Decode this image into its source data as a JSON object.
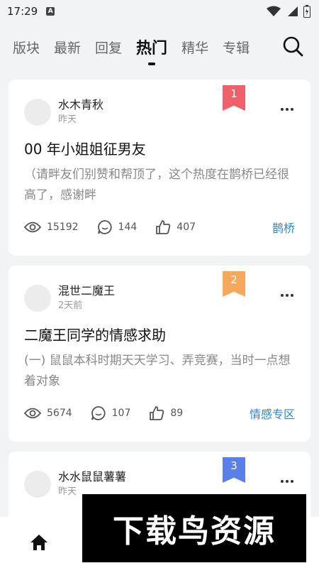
{
  "status_bar": {
    "time": "17:29",
    "notification_badge": "A"
  },
  "tabs": [
    {
      "label": "版块",
      "active": false
    },
    {
      "label": "最新",
      "active": false
    },
    {
      "label": "回复",
      "active": false
    },
    {
      "label": "热门",
      "active": true
    },
    {
      "label": "精华",
      "active": false
    },
    {
      "label": "专辑",
      "active": false
    }
  ],
  "icons": {
    "search": "search-icon",
    "more": "more-icon",
    "views": "eye-icon",
    "comments": "comment-icon",
    "likes": "thumbs-up-icon",
    "home": "home-icon"
  },
  "posts": [
    {
      "rank": "1",
      "rank_color": "#f0606a",
      "author": "水木青秋",
      "time": "昨天",
      "title": "00 年小姐姐征男友",
      "excerpt": "（请畔友们别赞和帮顶了，这个热度在鹊桥已经很高了，感谢畔",
      "views": "15192",
      "comments": "144",
      "likes": "407",
      "tag": "鹊桥"
    },
    {
      "rank": "2",
      "rank_color": "#f7a85a",
      "author": "混世二魔王",
      "time": "2天前",
      "title": "二魔王同学的情感求助",
      "excerpt": "(一) 鼠鼠本科时期天天学习、弄竞赛，当时一点想着对象",
      "views": "5674",
      "comments": "107",
      "likes": "89",
      "tag": "情感专区"
    },
    {
      "rank": "3",
      "rank_color": "#5b7fe8",
      "author": "水水鼠鼠薯薯",
      "time": "昨天"
    }
  ],
  "watermark": "下载鸟资源",
  "colors": {
    "accent": "#2a86d1",
    "background": "#f2f3f5"
  }
}
